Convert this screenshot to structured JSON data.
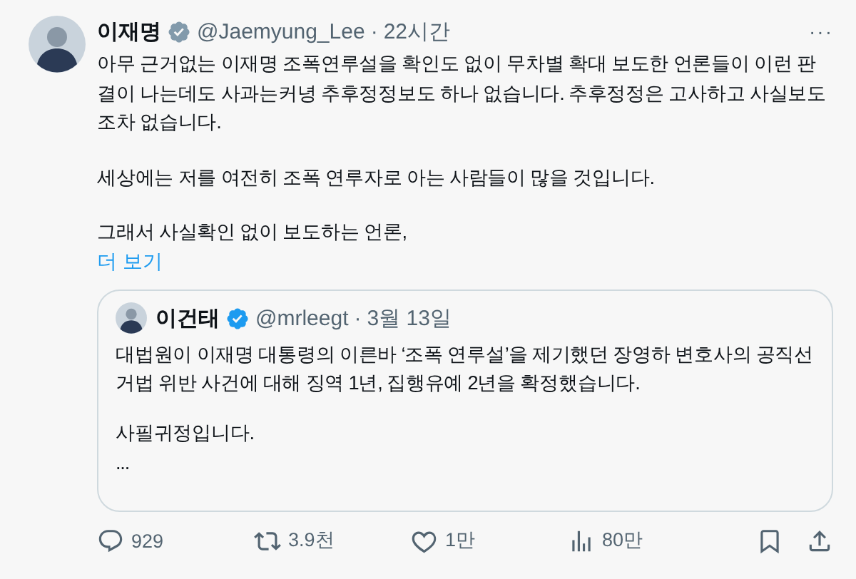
{
  "post": {
    "author": {
      "name": "이재명",
      "verified": true,
      "color": "#829aab",
      "handle": "@Jaemyung_Lee",
      "separator": "·",
      "time": "22시간"
    },
    "more_menu": "···",
    "paragraphs": [
      "아무 근거없는 이재명 조폭연루설을 확인도 없이 무차별 확대 보도한 언론들이 이런 판결이 나는데도 사과는커녕 추후정정보도 하나 없습니다. 추후정정은 고사하고 사실보도조차 없습니다.",
      "세상에는 저를 여전히 조폭 연루자로 아는 사람들이 많을 것입니다.",
      "그래서 사실확인 없이 보도하는 언론,"
    ],
    "show_more": "더 보기",
    "quote": {
      "author": {
        "name": "이건태",
        "verified": true,
        "color": "#1d9bf0",
        "handle": "@mrleegt",
        "separator": "·",
        "time": "3월 13일"
      },
      "paragraphs": [
        "대법원이 이재명 대통령의 이른바 ‘조폭 연루설’을 제기했던 장영하 변호사의 공직선거법 위반 사건에 대해 징역 1년, 집행유예 2년을 확정했습니다.",
        "사필귀정입니다.",
        "..."
      ]
    },
    "actions": [
      {
        "kind": "reply",
        "count": "929"
      },
      {
        "kind": "repost",
        "count": "3.9천"
      },
      {
        "kind": "like",
        "count": "1만"
      },
      {
        "kind": "views",
        "count": "80만"
      },
      {
        "kind": "bookmark"
      },
      {
        "kind": "share"
      }
    ]
  }
}
